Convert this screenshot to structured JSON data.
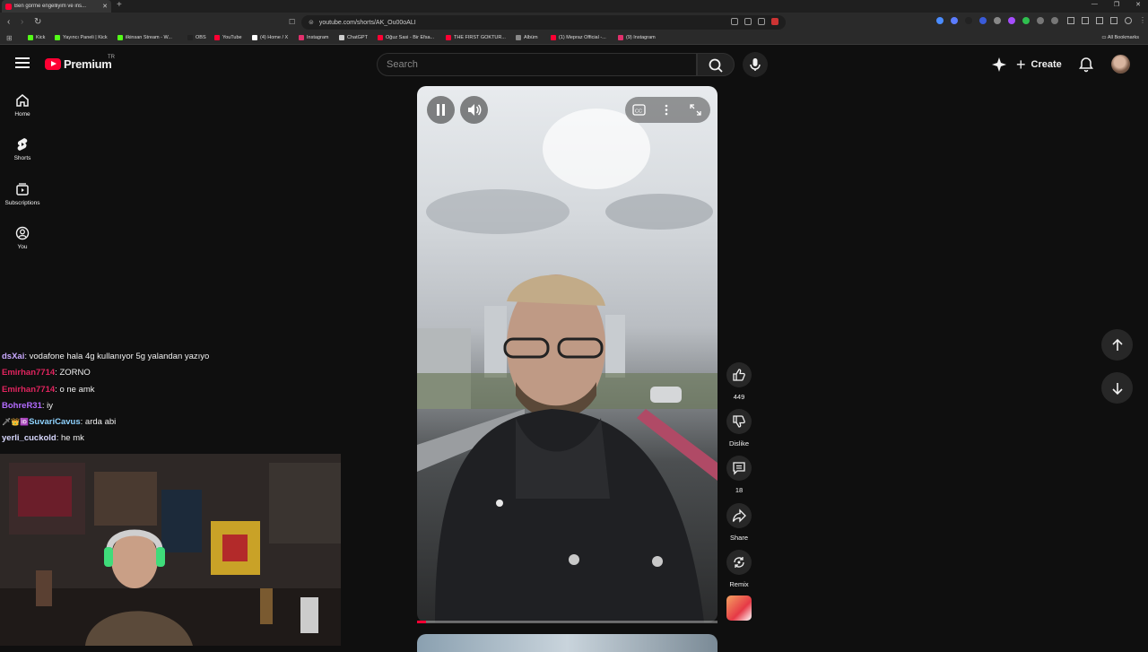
{
  "browser": {
    "tab_title": "Ben görme engelliyim ve ins...",
    "url": "youtube.com/shorts/AK_Ou00oALI",
    "bookmarks": [
      {
        "label": "Kick",
        "color": "#53fc18"
      },
      {
        "label": "Yayıncı Paneli | Kick",
        "color": "#53fc18"
      },
      {
        "label": "ilkinsan Stream - W...",
        "color": "#53fc18"
      },
      {
        "label": "OBS",
        "color": "#222222"
      },
      {
        "label": "YouTube",
        "color": "#ff0033"
      },
      {
        "label": "(4) Home / X",
        "color": "#ffffff"
      },
      {
        "label": "Instagram",
        "color": "#e1306c"
      },
      {
        "label": "ChatGPT",
        "color": "#cccccc"
      },
      {
        "label": "Oğuz Sasi - Bir Efsa...",
        "color": "#ff0033"
      },
      {
        "label": "THE FIRST GOKTUR...",
        "color": "#ff0033"
      },
      {
        "label": "Albüm",
        "color": "#888888"
      },
      {
        "label": "(1) Mepraz Official -...",
        "color": "#ff0033"
      },
      {
        "label": "(9) Instagram",
        "color": "#e1306c"
      }
    ],
    "all_bookmarks": "All Bookmarks"
  },
  "header": {
    "brand": "Premium",
    "country_code": "TR",
    "search_placeholder": "Search",
    "create_label": "Create"
  },
  "sidebar": {
    "items": [
      {
        "label": "Home",
        "icon": "home-icon"
      },
      {
        "label": "Shorts",
        "icon": "shorts-icon"
      },
      {
        "label": "Subscriptions",
        "icon": "subscriptions-icon"
      },
      {
        "label": "You",
        "icon": "you-icon"
      }
    ]
  },
  "chat": [
    {
      "user": "dsXai",
      "color": "#c9a9ff",
      "badges": "",
      "text": "vodafone hala 4g kullanıyor 5g yalandan yazıyo"
    },
    {
      "user": "Emirhan7714",
      "color": "#e0245e",
      "badges": "",
      "text": "ZORNO"
    },
    {
      "user": "Emirhan7714",
      "color": "#e0245e",
      "badges": "",
      "text": "o ne amk"
    },
    {
      "user": "BohreR31",
      "color": "#b36bff",
      "badges": "",
      "text": "iy"
    },
    {
      "user": "SuvariCavus",
      "color": "#8fd3ff",
      "badges": "🗡👑🆔",
      "text": "arda abi"
    },
    {
      "user": "yerli_cuckold",
      "color": "#d8d8ff",
      "badges": "",
      "text": "he mk"
    }
  ],
  "short": {
    "progress": 0.03,
    "likes": "449",
    "dislike_label": "Dislike",
    "comments": "18",
    "share_label": "Share",
    "remix_label": "Remix"
  },
  "colors": {
    "background": "#0f0f0f",
    "accent": "#ff0033",
    "button": "#272727"
  }
}
